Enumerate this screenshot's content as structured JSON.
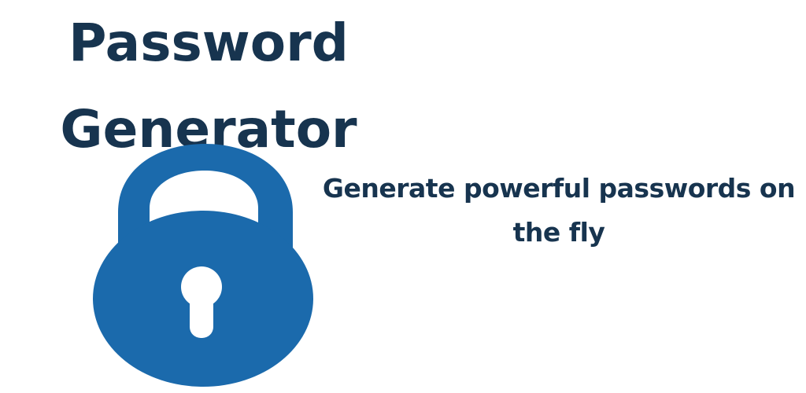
{
  "title": {
    "line1": "Password",
    "line2": "Generator"
  },
  "icon": {
    "name": "padlock-icon",
    "color": "#1b6aac"
  },
  "tagline": "Generate powerful passwords on the fly",
  "colors": {
    "text": "#17344f",
    "background": "#ffffff"
  }
}
